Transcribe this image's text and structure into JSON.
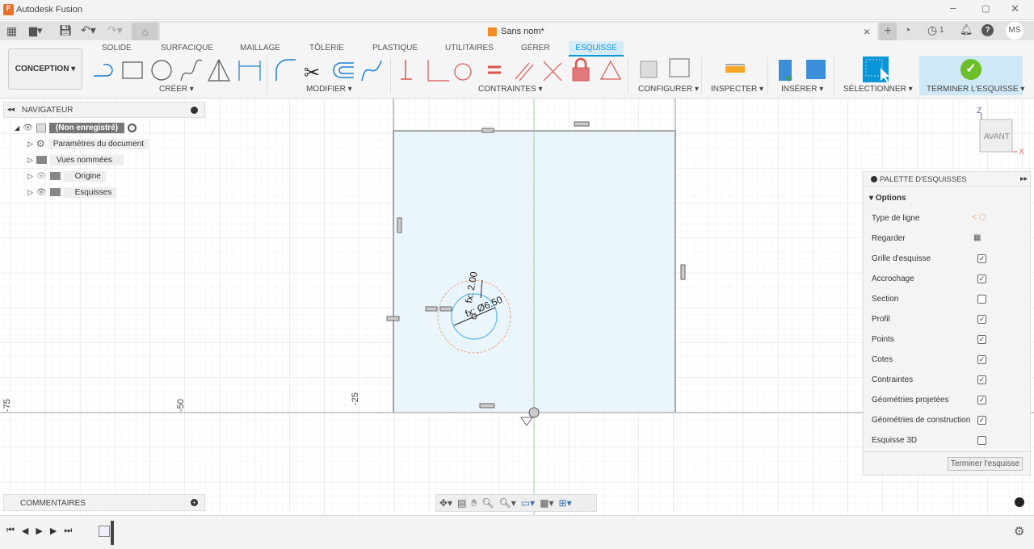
{
  "app": {
    "title": "Autodesk Fusion"
  },
  "document": {
    "tab_title": "Sans nom*",
    "close": "×"
  },
  "header": {
    "jobs_count": "1",
    "user_initials": "MS"
  },
  "workspace": {
    "label": "CONCEPTION ▾"
  },
  "ribbon_tabs": [
    {
      "label": "SOLIDE"
    },
    {
      "label": "SURFACIQUE"
    },
    {
      "label": "MAILLAGE"
    },
    {
      "label": "TÔLERIE"
    },
    {
      "label": "PLASTIQUE"
    },
    {
      "label": "UTILITAIRES"
    },
    {
      "label": "GÉRER"
    },
    {
      "label": "ESQUISSE",
      "active": true
    }
  ],
  "ribbon_groups": {
    "create": "CRÉER ▾",
    "modify": "MODIFIER ▾",
    "constraints": "CONTRAINTES ▾",
    "configure": "CONFIGURER ▾",
    "inspect": "INSPECTER ▾",
    "insert": "INSÉRER ▾",
    "select": "SÉLECTIONNER ▾",
    "finish": "TERMINER L'ESQUISSE ▾"
  },
  "navigator": {
    "title": "NAVIGATEUR",
    "root": "(Non enregistré)",
    "items": [
      {
        "label": "Paramètres du document"
      },
      {
        "label": "Vues nommées"
      },
      {
        "label": "Origine"
      },
      {
        "label": "Esquisses"
      }
    ]
  },
  "comments": {
    "title": "COMMENTAIRES"
  },
  "viewcube": {
    "face": "AVANT",
    "z": "Z",
    "x": "X"
  },
  "ruler": {
    "labels": [
      "-75",
      "-50",
      "-25"
    ]
  },
  "dimensions": {
    "diameter": "fx: Ø6.50",
    "offset": "fx: 2.00"
  },
  "palette": {
    "title": "PALETTE D'ESQUISSES",
    "section": "Options",
    "options": [
      {
        "label": "Type de ligne",
        "type": "icons"
      },
      {
        "label": "Regarder",
        "type": "icon"
      },
      {
        "label": "Grille d'esquisse",
        "checked": true
      },
      {
        "label": "Accrochage",
        "checked": true
      },
      {
        "label": "Section",
        "checked": false
      },
      {
        "label": "Profil",
        "checked": true
      },
      {
        "label": "Points",
        "checked": true
      },
      {
        "label": "Cotes",
        "checked": true
      },
      {
        "label": "Contraintes",
        "checked": true
      },
      {
        "label": "Géométries projetées",
        "checked": true
      },
      {
        "label": "Géométries de construction",
        "checked": true
      },
      {
        "label": "Esquisse 3D",
        "checked": false
      }
    ],
    "finish_button": "Terminer l'esquisse"
  },
  "colors": {
    "accent": "#0696d7",
    "sketch_fill": "#e8f3fb",
    "finish_bg": "#cfe8f6",
    "check_green": "#6cbf2a",
    "constraint_red": "#d9534f"
  }
}
